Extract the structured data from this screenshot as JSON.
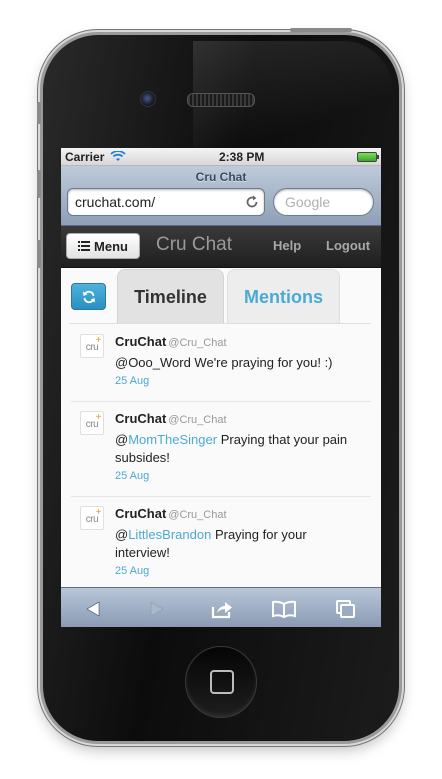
{
  "status_bar": {
    "carrier": "Carrier",
    "time": "2:38 PM"
  },
  "browser": {
    "page_title": "Cru Chat",
    "url": "cruchat.com/",
    "search_placeholder": "Google"
  },
  "navbar": {
    "menu_label": "Menu",
    "brand": "Cru Chat",
    "help": "Help",
    "logout": "Logout"
  },
  "tabs": {
    "timeline": "Timeline",
    "mentions": "Mentions",
    "active": "mentions"
  },
  "tweets": [
    {
      "avatar_text": "cru",
      "name": "CruChat",
      "handle": "@Cru_Chat",
      "prefix": "",
      "mention": "",
      "text": "@Ooo_Word We're praying for you! :)",
      "date": "25 Aug"
    },
    {
      "avatar_text": "cru",
      "name": "CruChat",
      "handle": "@Cru_Chat",
      "prefix": "@",
      "mention": "MomTheSinger",
      "text": " Praying that your pain subsides!",
      "date": "25 Aug"
    },
    {
      "avatar_text": "cru",
      "name": "CruChat",
      "handle": "@Cru_Chat",
      "prefix": "@",
      "mention": "LittlesBrandon",
      "text": " Praying for your interview!",
      "date": "25 Aug"
    }
  ],
  "colors": {
    "accent": "#4aaad4",
    "navbar_bg": "#2a2a2a",
    "safari_bar": "#a8b7ca"
  },
  "icons": {
    "toolbar": [
      "back-arrow-icon",
      "forward-arrow-icon",
      "share-icon",
      "bookmarks-icon",
      "tabs-icon"
    ],
    "refresh": "refresh-icon",
    "menu": "list-icon"
  }
}
